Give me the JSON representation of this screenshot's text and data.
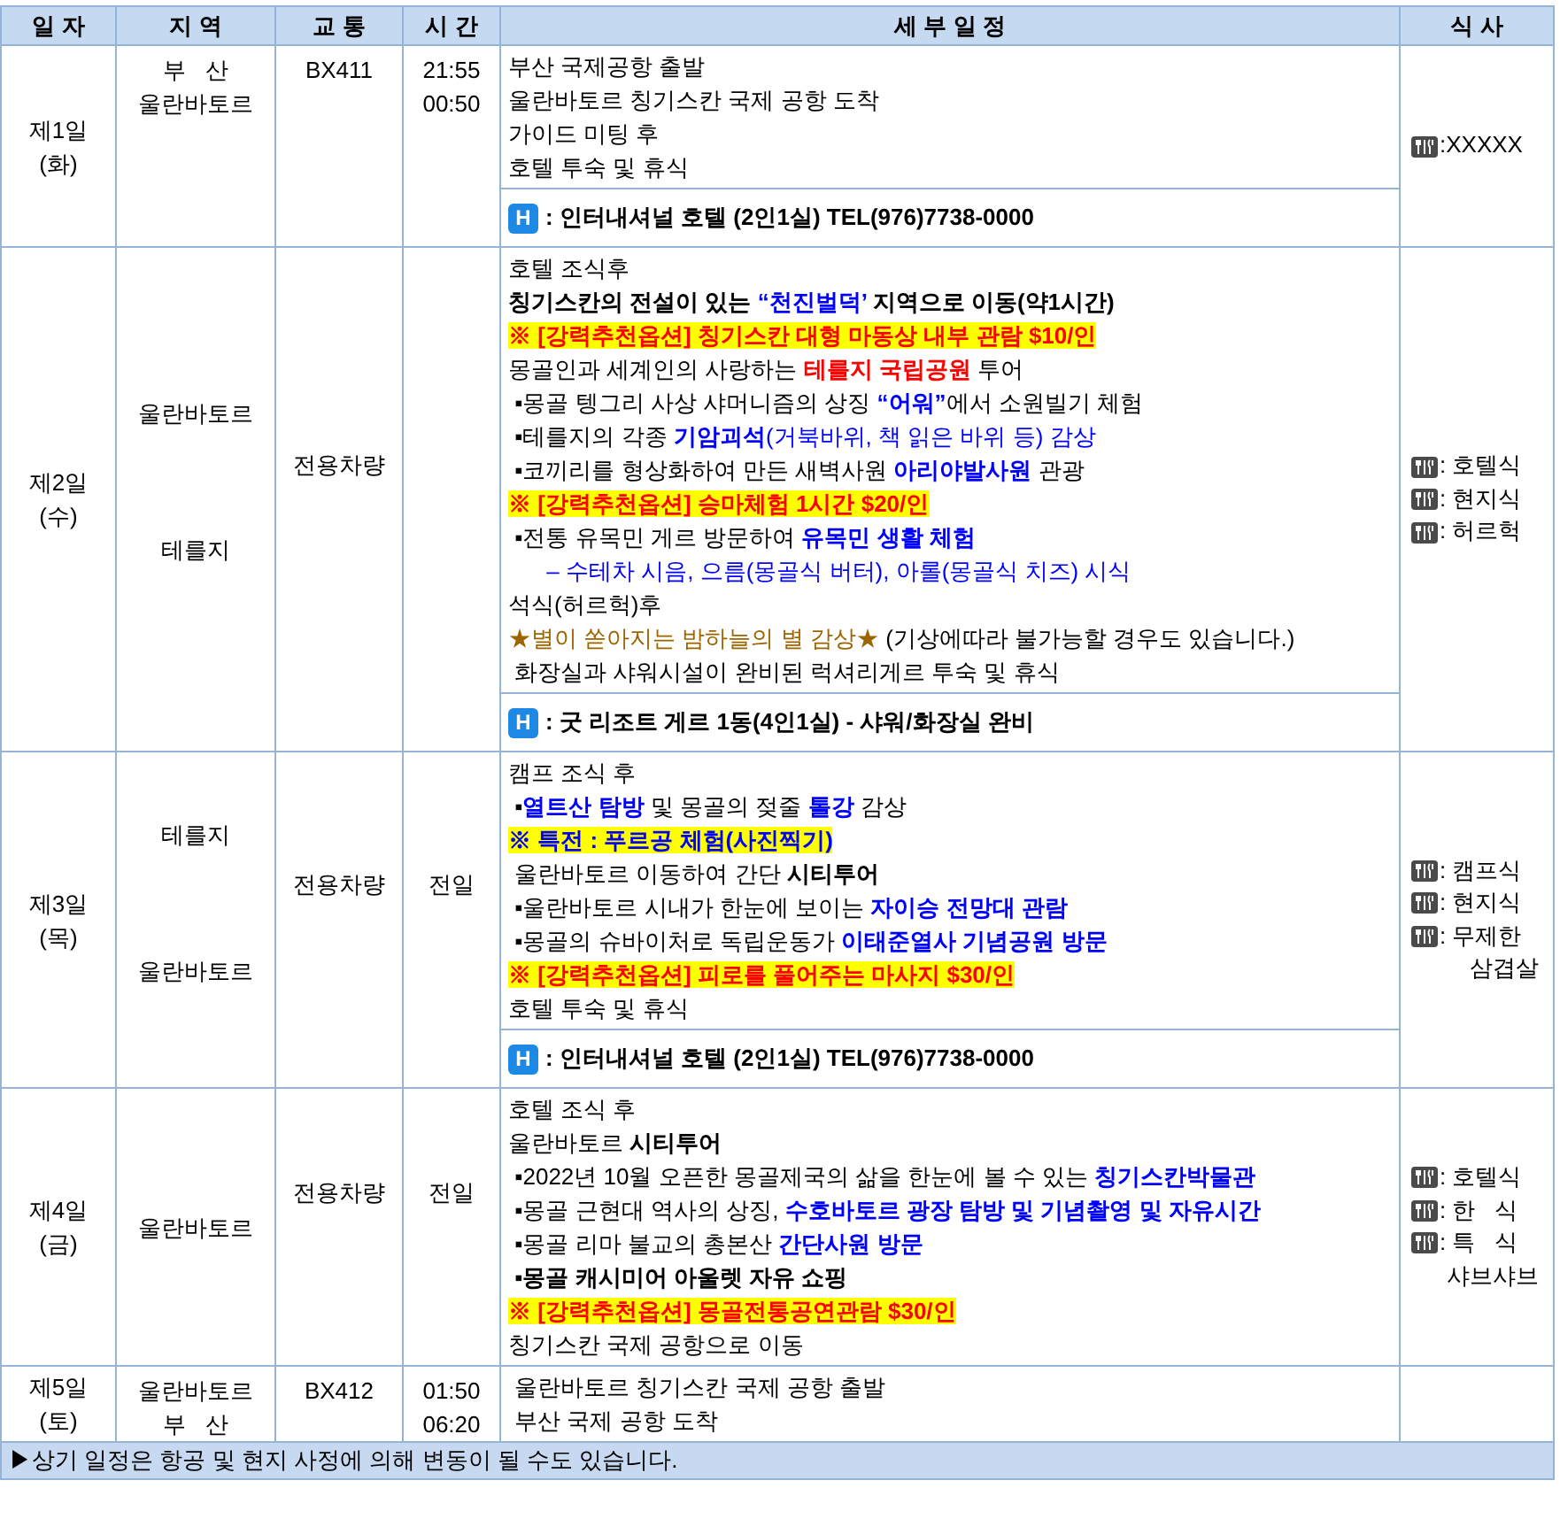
{
  "header": [
    "일 자",
    "지 역",
    "교 통",
    "시 간",
    "세 부 일 정",
    "식 사"
  ],
  "days": [
    {
      "kind": "flight",
      "day": "제1일",
      "weekday": "(화)",
      "region": {
        "kind": "tight",
        "places": [
          "부   산",
          "울란바토르"
        ]
      },
      "transport": "BX411",
      "times": [
        "21:55",
        "00:50"
      ],
      "lines": [
        {
          "highlight": false,
          "segments": [
            {
              "kind": "plain",
              "text": "부산 국제공항 출발"
            }
          ]
        },
        {
          "highlight": false,
          "segments": [
            {
              "kind": "plain",
              "text": "울란바토르 칭기스칸 국제 공항 도착"
            }
          ]
        },
        {
          "highlight": false,
          "segments": [
            {
              "kind": "plain",
              "text": "가이드 미팅 후"
            }
          ]
        },
        {
          "highlight": false,
          "segments": [
            {
              "kind": "plain",
              "text": "호텔 투숙 및 휴식"
            }
          ]
        }
      ],
      "hotel": {
        "badge": "H",
        "text": ": 인터내셔널 호텔 (2인1실) TEL(976)7738-0000"
      },
      "meals": [
        {
          "kind": "meal",
          "text": ":XXXXX"
        }
      ]
    },
    {
      "kind": "ground",
      "day": "제2일",
      "weekday": "(수)",
      "region": {
        "kind": "spread",
        "places": [
          "울란바토르",
          "테를지"
        ]
      },
      "transport": "전용차량",
      "lines": [
        {
          "highlight": false,
          "segments": [
            {
              "kind": "plain",
              "text": "호텔 조식후"
            }
          ]
        },
        {
          "highlight": false,
          "segments": [
            {
              "kind": "bold",
              "text": "칭기스칸의 전설이 있는 "
            },
            {
              "kind": "blue-bold",
              "text": "“천진벌덕’"
            },
            {
              "kind": "bold",
              "text": " 지역으로 이동(약1시간)"
            }
          ]
        },
        {
          "highlight": true,
          "segments": [
            {
              "kind": "red-bold",
              "text": "※ [강력추천옵션] 칭기스칸 대형 마동상 내부 관람 $10/인"
            }
          ]
        },
        {
          "highlight": false,
          "segments": [
            {
              "kind": "plain",
              "text": "몽골인과 세계인의 사랑하는 "
            },
            {
              "kind": "red-bold",
              "text": "테를지 국립공원"
            },
            {
              "kind": "plain",
              "text": " 투어"
            }
          ]
        },
        {
          "highlight": false,
          "segments": [
            {
              "kind": "plain",
              "text": " ▪몽골 텡그리 사상 샤머니즘의 상징 "
            },
            {
              "kind": "blue-bold",
              "text": "“어워”"
            },
            {
              "kind": "plain",
              "text": "에서 소원빌기 체험"
            }
          ]
        },
        {
          "highlight": false,
          "segments": [
            {
              "kind": "plain",
              "text": " ▪테를지의 각종 "
            },
            {
              "kind": "blue-bold",
              "text": "기암괴석"
            },
            {
              "kind": "blue",
              "text": "(거북바위, 책 읽은 바위 등) 감상"
            }
          ]
        },
        {
          "highlight": false,
          "segments": [
            {
              "kind": "plain",
              "text": " ▪코끼리를 형상화하여 만든 새벽사원 "
            },
            {
              "kind": "blue-bold",
              "text": "아리야발사원"
            },
            {
              "kind": "plain",
              "text": " 관광"
            }
          ]
        },
        {
          "highlight": true,
          "segments": [
            {
              "kind": "red-bold",
              "text": "※ [강력추천옵션] 승마체험 1시간 $20/인"
            }
          ]
        },
        {
          "highlight": false,
          "segments": [
            {
              "kind": "plain",
              "text": " ▪전통 유목민 게르 방문하여 "
            },
            {
              "kind": "blue-bold",
              "text": "유목민 생활 체험"
            }
          ]
        },
        {
          "highlight": false,
          "segments": [
            {
              "kind": "blue",
              "text": "      – 수테차 시음, 으름(몽골식 버터), 아롤(몽골식 치즈) 시식"
            }
          ]
        },
        {
          "highlight": false,
          "segments": [
            {
              "kind": "plain",
              "text": "석식(허르헉)후"
            }
          ]
        },
        {
          "highlight": false,
          "segments": [
            {
              "kind": "brown",
              "text": "★별이 쏟아지는 밤하늘의 별 감상★"
            },
            {
              "kind": "plain",
              "text": " (기상에따라 불가능할 경우도 있습니다.)"
            }
          ]
        },
        {
          "highlight": false,
          "segments": [
            {
              "kind": "plain",
              "text": " 화장실과 샤워시설이 완비된 럭셔리게르 투숙 및 휴식"
            }
          ]
        }
      ],
      "hotel": {
        "badge": "H",
        "text": ": 굿 리조트 게르 1동(4인1실) - 샤워/화장실 완비"
      },
      "meals": [
        {
          "kind": "meal",
          "text": ": 호텔식"
        },
        {
          "kind": "meal",
          "text": ": 현지식"
        },
        {
          "kind": "meal",
          "text": ": 허르헉"
        }
      ]
    },
    {
      "kind": "ground",
      "day": "제3일",
      "weekday": "(목)",
      "region": {
        "kind": "spread",
        "places": [
          "테를지",
          "울란바토르"
        ]
      },
      "transport": "전용차량",
      "times": [
        "전일"
      ],
      "lines": [
        {
          "highlight": false,
          "segments": [
            {
              "kind": "plain",
              "text": "캠프 조식 후"
            }
          ]
        },
        {
          "highlight": false,
          "segments": [
            {
              "kind": "plain",
              "text": " ▪"
            },
            {
              "kind": "blue-bold",
              "text": "열트산 탐방"
            },
            {
              "kind": "plain",
              "text": " 및 몽골의 젖줄 "
            },
            {
              "kind": "blue-bold",
              "text": "톨강"
            },
            {
              "kind": "plain",
              "text": " 감상"
            }
          ]
        },
        {
          "highlight": true,
          "segments": [
            {
              "kind": "blue-bold",
              "text": "※ 특전 : 푸르공 체험(사진찍기)"
            }
          ]
        },
        {
          "highlight": false,
          "segments": [
            {
              "kind": "plain",
              "text": " 울란바토르 이동하여 간단 "
            },
            {
              "kind": "bold",
              "text": "시티투어"
            }
          ]
        },
        {
          "highlight": false,
          "segments": [
            {
              "kind": "plain",
              "text": " ▪울란바토르 시내가 한눈에 보이는 "
            },
            {
              "kind": "blue-bold",
              "text": "자이승 전망대 관람"
            }
          ]
        },
        {
          "highlight": false,
          "segments": [
            {
              "kind": "plain",
              "text": " ▪몽골의 슈바이처로 독립운동가 "
            },
            {
              "kind": "blue-bold",
              "text": "이태준열사 기념공원 방문"
            }
          ]
        },
        {
          "highlight": true,
          "segments": [
            {
              "kind": "red-bold",
              "text": "※ [강력추천옵션] 피로를 풀어주는 마사지 $30/인"
            }
          ]
        },
        {
          "highlight": false,
          "segments": [
            {
              "kind": "plain",
              "text": "호텔 투숙 및 휴식"
            }
          ]
        }
      ],
      "hotel": {
        "badge": "H",
        "text": ": 인터내셔널 호텔 (2인1실) TEL(976)7738-0000"
      },
      "meals": [
        {
          "kind": "meal",
          "text": ": 캠프식"
        },
        {
          "kind": "meal",
          "text": ": 현지식"
        },
        {
          "kind": "meal",
          "text": ": 무제한"
        },
        {
          "kind": "continuation",
          "text": "삼겹살"
        }
      ]
    },
    {
      "kind": "ground",
      "day": "제4일",
      "weekday": "(금)",
      "region": {
        "kind": "tight",
        "places": [
          "울란바토르"
        ]
      },
      "transport": "전용차량",
      "times": [
        "전일"
      ],
      "lines": [
        {
          "highlight": false,
          "segments": [
            {
              "kind": "plain",
              "text": "호텔 조식 후"
            }
          ]
        },
        {
          "highlight": false,
          "segments": [
            {
              "kind": "plain",
              "text": "울란바토르 "
            },
            {
              "kind": "bold",
              "text": "시티투어"
            }
          ]
        },
        {
          "highlight": false,
          "segments": [
            {
              "kind": "plain",
              "text": " ▪2022년 10월 오픈한 몽골제국의 삶을 한눈에 볼 수 있는 "
            },
            {
              "kind": "blue-bold",
              "text": "칭기스칸박물관"
            }
          ]
        },
        {
          "highlight": false,
          "segments": [
            {
              "kind": "plain",
              "text": " ▪몽골 근현대 역사의 상징, "
            },
            {
              "kind": "blue-bold",
              "text": "수호바토르 광장 탐방 및 기념촬영 및 자유시간"
            }
          ]
        },
        {
          "highlight": false,
          "segments": [
            {
              "kind": "plain",
              "text": " ▪몽골 리마 불교의 총본산 "
            },
            {
              "kind": "blue-bold",
              "text": "간단사원 방문"
            }
          ]
        },
        {
          "highlight": false,
          "segments": [
            {
              "kind": "bold",
              "text": " ▪몽골 캐시미어 아울렛 자유 쇼핑"
            }
          ]
        },
        {
          "highlight": true,
          "segments": [
            {
              "kind": "red-bold",
              "text": "※ [강력추천옵션] 몽골전통공연관람 $30/인"
            }
          ]
        },
        {
          "highlight": false,
          "segments": [
            {
              "kind": "plain",
              "text": "칭기스칸 국제 공항으로 이동"
            }
          ]
        }
      ],
      "meals": [
        {
          "kind": "meal",
          "text": ": 호텔식"
        },
        {
          "kind": "meal",
          "text": ": 한   식"
        },
        {
          "kind": "meal",
          "text": ": 특   식"
        },
        {
          "kind": "continuation",
          "text": "샤브샤브"
        }
      ]
    },
    {
      "kind": "flight",
      "day": "제5일",
      "weekday": "(토)",
      "region": {
        "kind": "tight",
        "places": [
          "울란바토르",
          "부   산"
        ]
      },
      "transport": "BX412",
      "times": [
        "01:50",
        "06:20"
      ],
      "lines": [
        {
          "highlight": false,
          "segments": [
            {
              "kind": "plain",
              "text": " 울란바토르 칭기스칸 국제 공항 출발"
            }
          ]
        },
        {
          "highlight": false,
          "segments": [
            {
              "kind": "plain",
              "text": " 부산 국제 공항 도착"
            }
          ]
        }
      ]
    }
  ],
  "footer": "▶상기 일정은 항공 및 현지 사정에 의해 변동이 될 수도 있습니다."
}
